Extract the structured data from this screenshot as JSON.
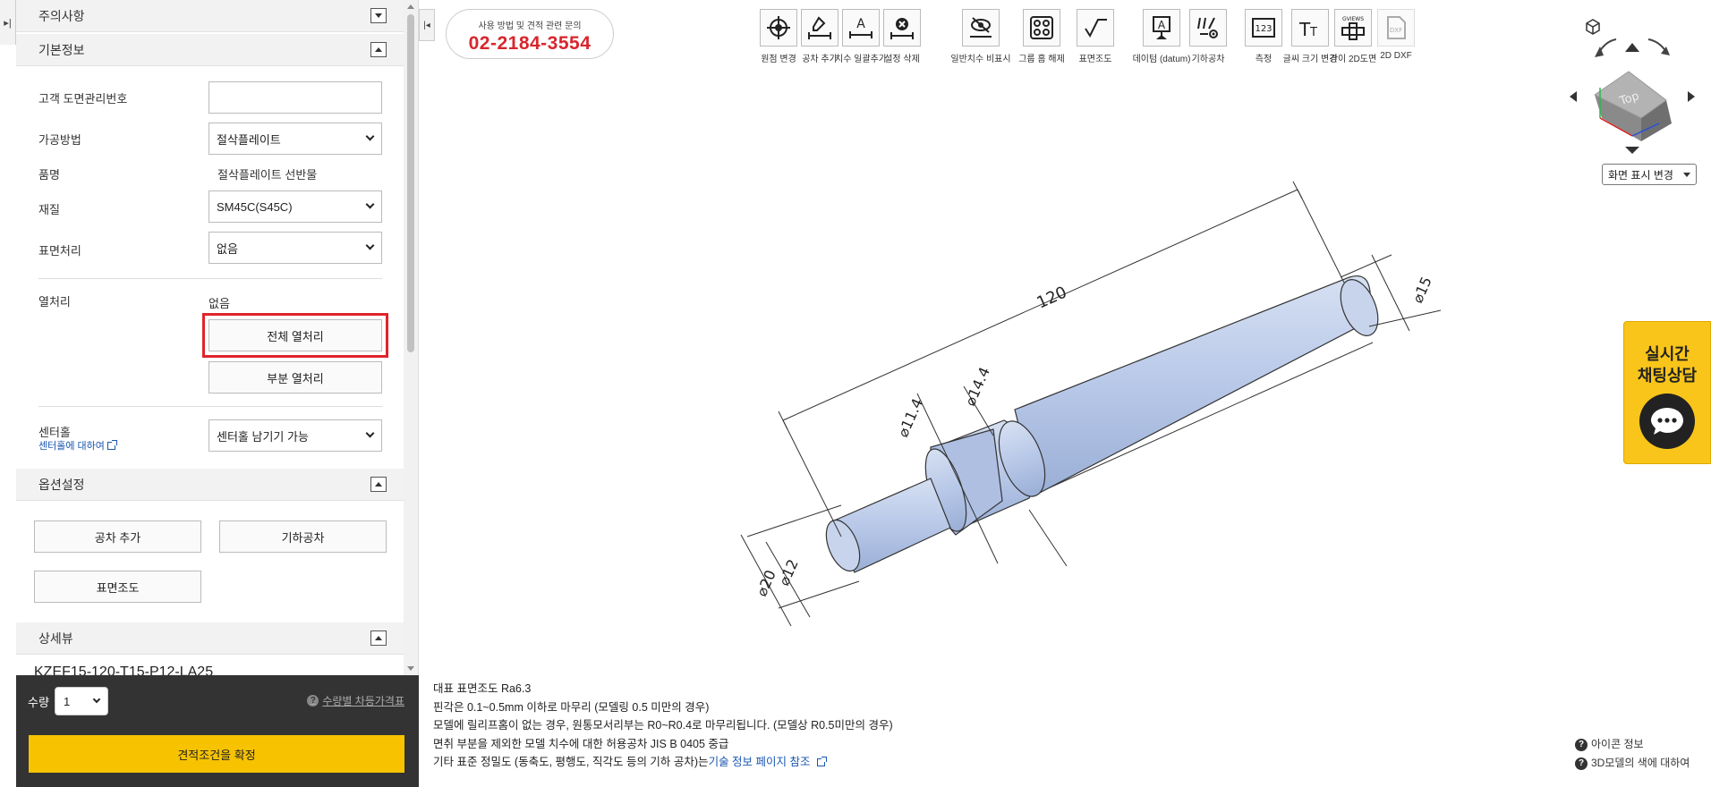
{
  "left_panel": {
    "sections": {
      "caution": "주의사항",
      "basic": "기본정보",
      "options": "옵션설정",
      "detail": "상세뷰"
    },
    "fields": {
      "drawing_no_label": "고객 도면관리번호",
      "drawing_no_value": "",
      "process_label": "가공방법",
      "process_value": "절삭플레이트",
      "product_label": "품명",
      "product_value": "절삭플레이트 선반물",
      "material_label": "재질",
      "material_value": "SM45C(S45C)",
      "surface_label": "표면처리",
      "surface_value": "없음",
      "heat_label": "열처리",
      "heat_value": "없음",
      "heat_full_button": "전체 열처리",
      "heat_partial_button": "부분 열처리",
      "center_label": "센터홀",
      "center_link": "센터홀에 대하여",
      "center_value": "센터홀 남기기 가능"
    },
    "option_buttons": {
      "tolerance": "공차 추가",
      "geometric": "기하공차",
      "roughness": "표면조도"
    },
    "detail_text": "KZEF15-120-T15-P12-LA25"
  },
  "bottom": {
    "qty_label": "수량",
    "qty_value": "1",
    "qty_link": "수량별 차등가격표",
    "confirm_button": "견적조건을 확정"
  },
  "contact": {
    "small_text": "사용 방법 및 견적 관련 문의",
    "phone": "02-2184-3554"
  },
  "toolbar": {
    "origin": "원점 변경",
    "add_tol": "공차 추가",
    "dim_batch": "치수 일괄추가",
    "del_setting": "설정 삭제",
    "hide_general": "일반치수 비표시",
    "ungroup": "그룹 홈 해제",
    "roughness": "표면조도",
    "datum": "데이텀 (datum)",
    "geo_tol": "기하공차",
    "measure": "측정",
    "font_size": "글씨 크기 변경",
    "simple_2d": "간이 2D도면",
    "dxf_2d": "2D DXF",
    "gviews": "GVIEWS",
    "measure_icon_text": "123",
    "dxf_icon_text": "DXF"
  },
  "viewcube": {
    "face_label": "Top",
    "view_select": "화면 표시 변경"
  },
  "chat": {
    "line1": "실시간",
    "line2": "채팅상담"
  },
  "drawing": {
    "dim_120": "120",
    "dim_15": "⌀15",
    "dim_14_4": "⌀14.4",
    "dim_11_4": "⌀11.4",
    "dim_12": "⌀12",
    "dim_20": "⌀20",
    "body_color": "#b8c8e8"
  },
  "notes": {
    "line1": "대표 표면조도 Ra6.3",
    "line2": "핀각은 0.1~0.5mm 이하로 마무리 (모델링 0.5 미만의 경우)",
    "line3": "모델에 릴리프홈이 없는 경우, 원통모서리부는 R0~R0.4로 마무리됩니다. (모델상 R0.5미만의 경우)",
    "line4": "면취 부분을 제외한 모델 치수에 대한 허용공차 JIS B 0405 중급",
    "line5_prefix": "기타 표준 정밀도 (동축도, 평행도, 직각도 등의 기하 공차)는",
    "line5_link": "기술 정보 페이지 참조"
  },
  "help_links": {
    "icon_info": "아이콘 정보",
    "model_color": "3D모델의 색에 대하여"
  }
}
